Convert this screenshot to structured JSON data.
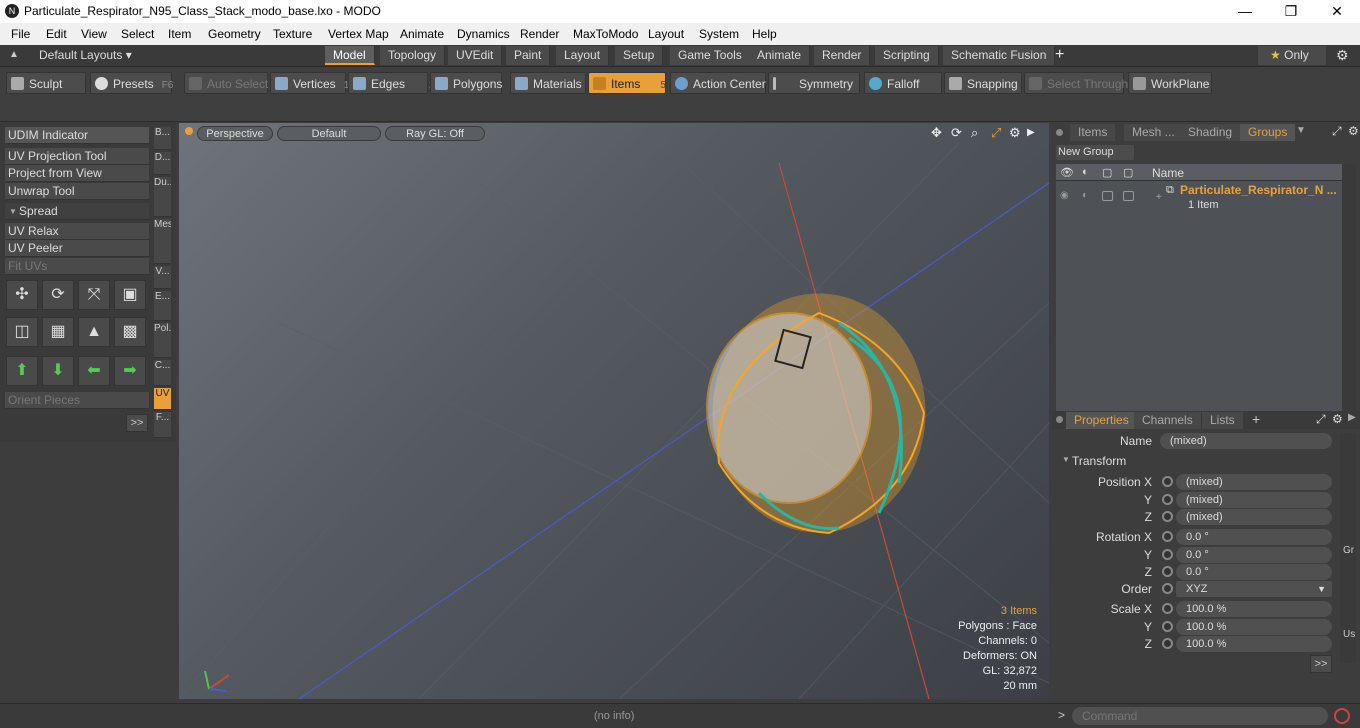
{
  "window": {
    "title": "Particulate_Respirator_N95_Class_Stack_modo_base.lxo - MODO",
    "app_icon": "N",
    "minimize": "—",
    "maximize": "❐",
    "close": "✕"
  },
  "menu": [
    "File",
    "Edit",
    "View",
    "Select",
    "Item",
    "Geometry",
    "Texture",
    "Vertex Map",
    "Animate",
    "Dynamics",
    "Render",
    "MaxToModo",
    "Layout",
    "System",
    "Help"
  ],
  "layouts": {
    "label": "Default Layouts",
    "tabs": [
      "Model",
      "Topology",
      "UVEdit",
      "Paint",
      "Layout",
      "Setup",
      "Game Tools",
      "Animate",
      "Render",
      "Scripting",
      "Schematic Fusion"
    ],
    "only_label": "Only"
  },
  "toolbar": {
    "sculpt": "Sculpt",
    "presets": "Presets",
    "presets_key": "F6",
    "auto_select": "Auto Select",
    "vertices": "Vertices",
    "vertices_num": "1",
    "edges": "Edges",
    "edges_num": "2",
    "polygons": "Polygons",
    "materials": "Materials",
    "items": "Items",
    "items_num": "5",
    "action_center": "Action Center",
    "symmetry": "Symmetry",
    "falloff": "Falloff",
    "snapping": "Snapping",
    "select_through": "Select Through",
    "workplane": "WorkPlane"
  },
  "left": {
    "items": [
      "UDIM Indicator",
      "UV Projection Tool",
      "Project from View",
      "Unwrap Tool",
      "Spread",
      "UV Relax",
      "UV Peeler",
      "Fit UVs"
    ],
    "orient": "Orient Pieces",
    "more": ">>",
    "vtabs": [
      "B...",
      "D...",
      "Du...",
      "Mes...",
      "V...",
      "E...",
      "Pol...",
      "C...",
      "UV",
      "F..."
    ]
  },
  "viewport": {
    "perspective": "Perspective",
    "default": "Default",
    "raygl": "Ray GL: Off",
    "info_items": "3 Items",
    "info_polygons": "Polygons : Face",
    "info_channels": "Channels: 0",
    "info_deformers": "Deformers: ON",
    "info_gl": "GL: 32,872",
    "info_scale": "20 mm"
  },
  "status": {
    "info": "(no info)",
    "command_placeholder": "Command"
  },
  "groups": {
    "tabs": [
      "Items",
      "Mesh ...",
      "Shading",
      "Groups"
    ],
    "new_group": "New Group",
    "col_name": "Name",
    "item_name": "Particulate_Respirator_N ...",
    "item_count": "1 Item"
  },
  "props": {
    "tabs": [
      "Properties",
      "Channels",
      "Lists"
    ],
    "name_label": "Name",
    "name_value": "(mixed)",
    "transform": "Transform",
    "rows": [
      {
        "label": "Position X",
        "value": "(mixed)"
      },
      {
        "label": "Y",
        "value": "(mixed)"
      },
      {
        "label": "Z",
        "value": "(mixed)"
      },
      {
        "label": "Rotation X",
        "value": "0.0 °"
      },
      {
        "label": "Y",
        "value": "0.0 °"
      },
      {
        "label": "Z",
        "value": "0.0 °"
      }
    ],
    "order_label": "Order",
    "order_value": "XYZ",
    "scale": [
      {
        "label": "Scale X",
        "value": "100.0 %"
      },
      {
        "label": "Y",
        "value": "100.0 %"
      },
      {
        "label": "Z",
        "value": "100.0 %"
      }
    ],
    "side_gr": "Gr",
    "side_us": "Us",
    "more": ">>"
  },
  "colors": {
    "accent": "#e8a03a",
    "mesh": "#f5a623",
    "strap": "#2bb5a0"
  }
}
